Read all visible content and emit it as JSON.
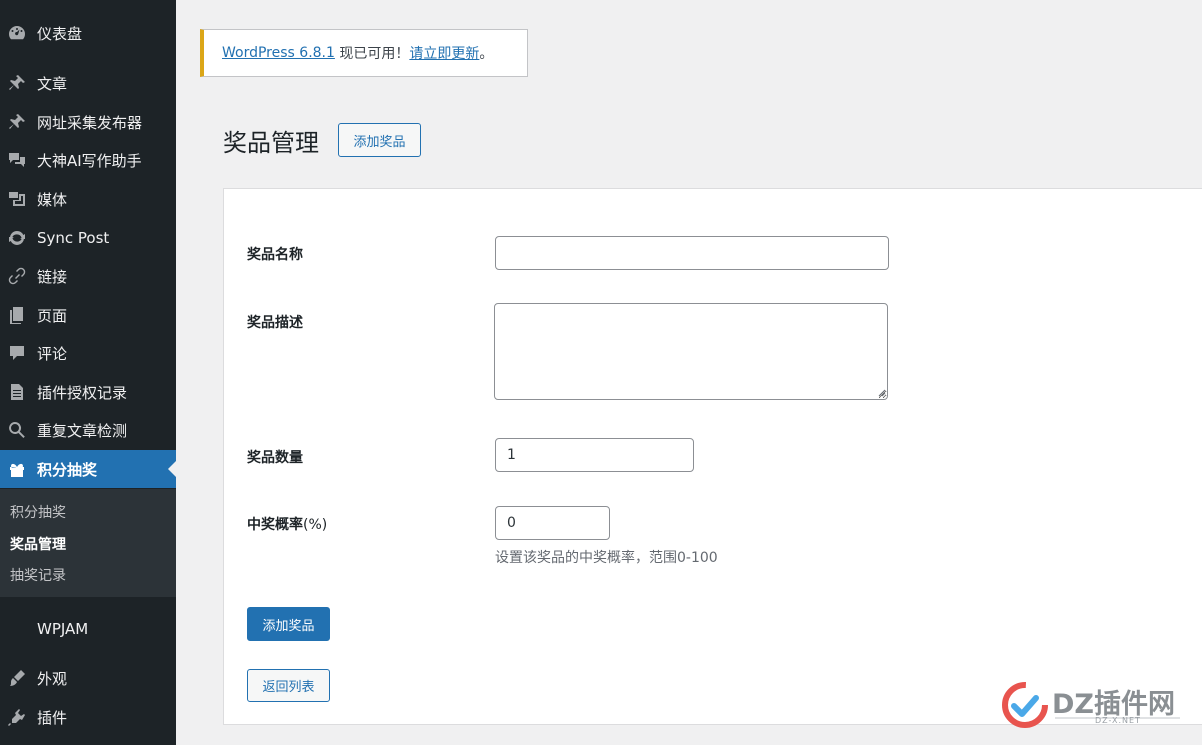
{
  "sidebar": {
    "items": [
      {
        "label": "仪表盘",
        "icon": "dashboard-icon"
      },
      {
        "label": "文章",
        "icon": "pin-icon"
      },
      {
        "label": "网址采集发布器",
        "icon": "pin-icon"
      },
      {
        "label": "大神AI写作助手",
        "icon": "comments-icon"
      },
      {
        "label": "媒体",
        "icon": "media-icon"
      },
      {
        "label": "Sync Post",
        "icon": "sync-icon"
      },
      {
        "label": "链接",
        "icon": "link-icon"
      },
      {
        "label": "页面",
        "icon": "page-icon"
      },
      {
        "label": "评论",
        "icon": "comment-icon"
      },
      {
        "label": "插件授权记录",
        "icon": "document-icon"
      },
      {
        "label": "重复文章检测",
        "icon": "search-icon"
      },
      {
        "label": "积分抽奖",
        "icon": "gift-icon",
        "current": true
      }
    ],
    "submenu": [
      {
        "label": "积分抽奖"
      },
      {
        "label": "奖品管理",
        "current": true
      },
      {
        "label": "抽奖记录"
      }
    ],
    "items_after": [
      {
        "label": "WPJAM",
        "icon": ""
      },
      {
        "label": "外观",
        "icon": "appearance-icon"
      },
      {
        "label": "插件",
        "icon": "plugin-icon"
      }
    ]
  },
  "notice": {
    "link_version": "WordPress 6.8.1",
    "middle_text": " 现已可用！",
    "link_update": "请立即更新",
    "end_text": "。"
  },
  "page": {
    "title": "奖品管理",
    "add_button": "添加奖品"
  },
  "form": {
    "name_label": "奖品名称",
    "name_value": "",
    "desc_label": "奖品描述",
    "desc_value": "",
    "quantity_label": "奖品数量",
    "quantity_value": "1",
    "prob_label": "中奖概率",
    "prob_unit": "(%)",
    "prob_value": "0",
    "prob_help": "设置该奖品的中奖概率，范围0-100",
    "submit_label": "添加奖品",
    "back_label": "返回列表"
  },
  "watermark": {
    "text": "DZ插件网",
    "sub": "DZ-X.NET"
  },
  "colors": {
    "sidebar_bg": "#1d2327",
    "accent": "#2271b1",
    "notice_border": "#dba617",
    "page_bg": "#f0f0f1"
  }
}
